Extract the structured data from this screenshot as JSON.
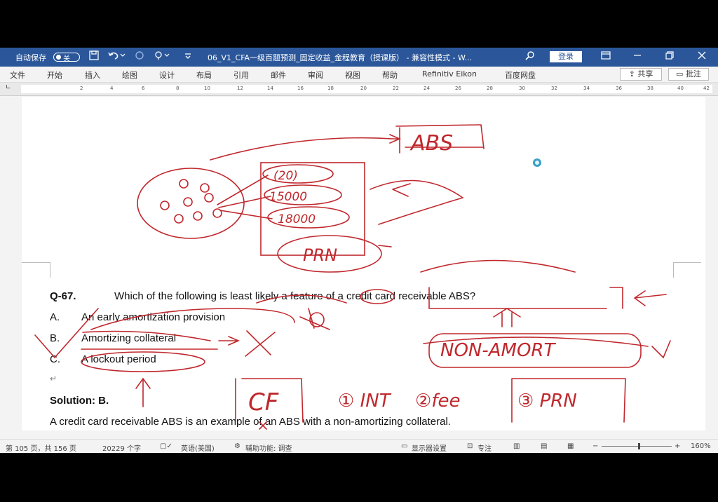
{
  "titlebar": {
    "autosave_label": "自动保存",
    "autosave_state": "关",
    "doc_title": "06_V1_CFA一级百题预测_固定收益_金程教育（授课版）  -  兼容性模式  -  W...",
    "login_label": "登录",
    "icons": [
      "save-icon",
      "undo-icon",
      "redo-icon",
      "touch-mode-icon",
      "customize-icon",
      "search-icon",
      "ribbon-display-icon",
      "minimize-icon",
      "restore-icon",
      "close-icon"
    ]
  },
  "menu": {
    "items": [
      "文件",
      "开始",
      "插入",
      "绘图",
      "设计",
      "布局",
      "引用",
      "邮件",
      "审阅",
      "视图",
      "帮助",
      "Refinitiv Eikon",
      "百度网盘"
    ],
    "share_label": "共享",
    "comment_label": "批注"
  },
  "ruler": {
    "ticks": [
      "2",
      "4",
      "6",
      "8",
      "10",
      "12",
      "14",
      "16",
      "18",
      "20",
      "22",
      "24",
      "26",
      "28",
      "30",
      "32",
      "34",
      "36",
      "38",
      "40",
      "42"
    ]
  },
  "document": {
    "question_number": "Q-67.",
    "question_text": "Which of the following is least likely a feature of a credit card receivable ABS?",
    "options": [
      {
        "letter": "A.",
        "text": "An early amortization provision"
      },
      {
        "letter": "B.",
        "text": "Amortizing collateral"
      },
      {
        "letter": "C.",
        "text": "A lockout period"
      }
    ],
    "solution_label": "Solution: B.",
    "solution_text": "A credit card receivable ABS is an example of an ABS with a non-amortizing collateral."
  },
  "annotations": {
    "abs": "ABS",
    "n1": "(20)",
    "n2": "15000",
    "n3": "18000",
    "prn": "PRN",
    "non_amort": "NON-AMORT",
    "cf": "CF",
    "int": "① INT",
    "fee": "②fee",
    "prn2": "③ PRN"
  },
  "status": {
    "page": "第 105 页，共 156 页",
    "words": "20229 个字",
    "language": "英语(美国)",
    "accessibility": "辅助功能: 调查",
    "display_settings": "显示器设置",
    "focus": "专注",
    "zoom": "160%"
  },
  "colors": {
    "titlebar": "#2b579a",
    "ink": "#c0282d",
    "link_underline": "#4a7bd0"
  }
}
